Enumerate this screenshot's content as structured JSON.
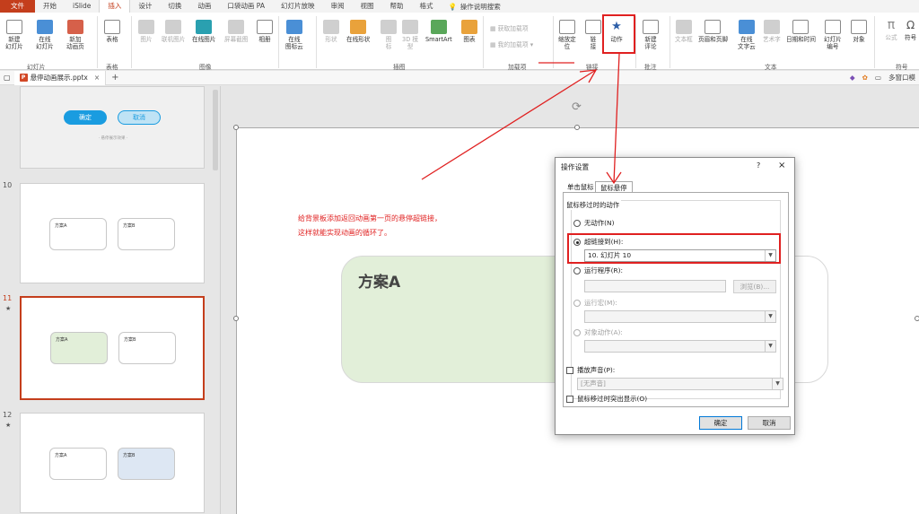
{
  "tabs": [
    "文件",
    "开始",
    "iSlide",
    "插入",
    "设计",
    "切换",
    "动画",
    "口袋动画 PA",
    "幻灯片放映",
    "审阅",
    "视图",
    "帮助",
    "格式"
  ],
  "tell_me": "操作说明搜索",
  "ribbon": {
    "slides": {
      "new_slide": "新建\n幻灯片",
      "online_slide": "在线\n幻灯片",
      "new_anim_page": "新加\n动画页",
      "group": "幻灯片"
    },
    "table": {
      "table": "表格",
      "group": "表格"
    },
    "image": {
      "picture": "图片",
      "online_picture": "联机图片",
      "online_image": "在线图片",
      "screenshot": "屏幕截图",
      "album": "相册",
      "group": "图像"
    },
    "icon_cloud": {
      "label": "在线\n图标云"
    },
    "illus": {
      "shapes": "形状",
      "online_shapes": "在线形状",
      "icons": "图\n标",
      "model3d": "3D 模\n型",
      "smartart": "SmartArt",
      "chart": "图表",
      "group": "插图"
    },
    "addins": {
      "get": "获取加载项",
      "mine": "我的加载项",
      "group": "加载项"
    },
    "links": {
      "zoom": "缩放定\n位",
      "link": "链\n接",
      "action": "动作",
      "group": "链接"
    },
    "comments": {
      "new": "新建\n评论",
      "group": "批注"
    },
    "text": {
      "textbox": "文本框",
      "header_footer": "页眉和页脚",
      "online_text": "在线\n文字云",
      "wordart": "艺术字",
      "datetime": "日期和时间",
      "slide_num": "幻灯片\n编号",
      "object": "对象",
      "group": "文本"
    },
    "symbols": {
      "equation": "公式",
      "symbol": "符号",
      "group": "符号"
    }
  },
  "doc_tab": "悬停动画展示.pptx",
  "multi_window": "多窗口模",
  "thumbs": {
    "top_confirm": "确定",
    "top_cancel": "取消",
    "top_caption": "· 悬停展示效果 ·",
    "slide10": {
      "num": "10",
      "a": "方案A",
      "b": "方案B"
    },
    "slide11": {
      "num": "11",
      "a": "方案A",
      "b": "方案B"
    },
    "slide12": {
      "num": "12",
      "a": "方案A",
      "b": "方案B"
    },
    "star": "★"
  },
  "annotation": {
    "line1": "给背景板添加返回动画第一页的悬停超链接，",
    "line2": "这样就能实现动画的循环了。"
  },
  "slide": {
    "card_a": "方案A"
  },
  "dialog": {
    "title": "操作设置",
    "help": "?",
    "close": "×",
    "tab_click": "单击鼠标",
    "tab_hover": "鼠标悬停",
    "legend": "鼠标移过时的动作",
    "none": "无动作(N)",
    "hyperlink": "超链接到(H):",
    "hyperlink_value": "10. 幻灯片 10",
    "run_program": "运行程序(R):",
    "browse": "浏览(B)...",
    "run_macro": "运行宏(M):",
    "object_action": "对象动作(A):",
    "play_sound": "播放声音(P):",
    "sound_value": "[无声音]",
    "highlight": "鼠标移过时突出显示(O)",
    "ok": "确定",
    "cancel": "取消"
  }
}
